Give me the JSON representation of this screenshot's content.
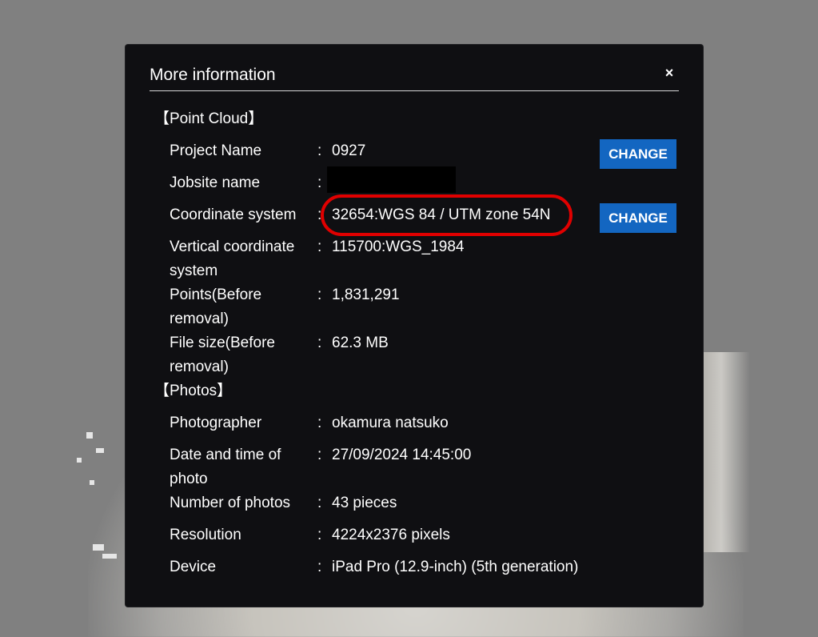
{
  "modal": {
    "title": "More information",
    "close_label": "×"
  },
  "point_cloud": {
    "section_title": "【Point Cloud】",
    "rows": [
      {
        "label": "Project Name",
        "value": "0927",
        "has_change": true
      },
      {
        "label": "Jobsite name",
        "value": "",
        "redacted": true
      },
      {
        "label": "Coordinate system",
        "value": "32654:WGS 84 / UTM zone 54N",
        "has_change": true
      },
      {
        "label_line1": "Vertical coordinate",
        "label_line2": "system",
        "value": "115700:WGS_1984"
      },
      {
        "label_line1": "Points(Before",
        "label_line2": "removal)",
        "value": "1,831,291"
      },
      {
        "label_line1": "File size(Before",
        "label_line2": "removal)",
        "value": "62.3 MB"
      }
    ],
    "change_label": "CHANGE"
  },
  "photos": {
    "section_title": "【Photos】",
    "rows": [
      {
        "label": "Photographer",
        "value": "okamura natsuko"
      },
      {
        "label_line1": "Date and time of",
        "label_line2": "photo",
        "value": "27/09/2024 14:45:00"
      },
      {
        "label": "Number of photos",
        "value": "43 pieces"
      },
      {
        "label": "Resolution",
        "value": "4224x2376 pixels"
      },
      {
        "label": "Device",
        "value": "iPad Pro (12.9-inch) (5th generation)"
      }
    ]
  },
  "separator": ":",
  "colors": {
    "modal_bg": "#0f0f12",
    "button_bg": "#1366c1",
    "highlight": "#e00000",
    "backdrop": "#808080"
  }
}
